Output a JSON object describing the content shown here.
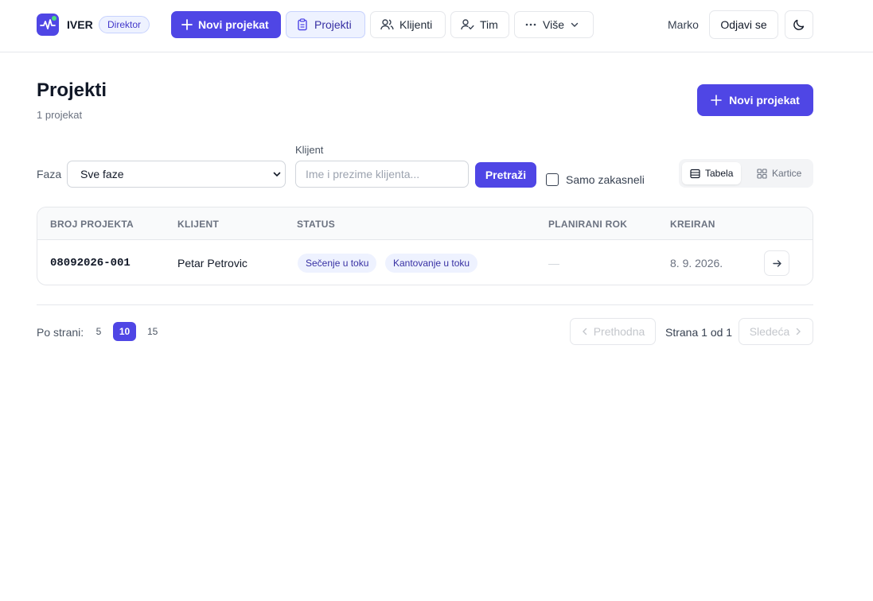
{
  "app": {
    "brand": "IVER",
    "role": "Direktor",
    "accent": "#4f46e5"
  },
  "nav": {
    "new_project": "Novi projekat",
    "projects": "Projekti",
    "clients": "Klijenti",
    "team": "Tim",
    "more": "Više",
    "user": "Marko",
    "logout": "Odjavi se"
  },
  "page": {
    "title": "Projekti",
    "count": "1 projekat",
    "new_project": "Novi projekat"
  },
  "filters": {
    "phase_label": "Faza",
    "phase_value": "Sve faze",
    "client_label": "Klijent",
    "client_placeholder": "Ime i prezime klijenta...",
    "client_value": "",
    "search": "Pretraži",
    "late_only": "Samo zakasneli",
    "late_only_checked": false
  },
  "view": {
    "table": "Tabela",
    "cards": "Kartice",
    "selected": "Tabela"
  },
  "table": {
    "headers": [
      "BROJ PROJEKTA",
      "KLIJENT",
      "STATUS",
      "PLANIRANI ROK",
      "KREIRAN"
    ],
    "rows": [
      {
        "number": "08092026-001",
        "client": "Petar Petrovic",
        "statuses": [
          "Sečenje u toku",
          "Kantovanje u toku"
        ],
        "deadline": "—",
        "created": "8. 9. 2026."
      }
    ]
  },
  "pagination": {
    "per_page_label": "Po strani:",
    "options": [
      "5",
      "10",
      "15"
    ],
    "selected": "10",
    "prev": "Prethodna",
    "info": "Strana 1 od 1",
    "next": "Sledeća"
  }
}
